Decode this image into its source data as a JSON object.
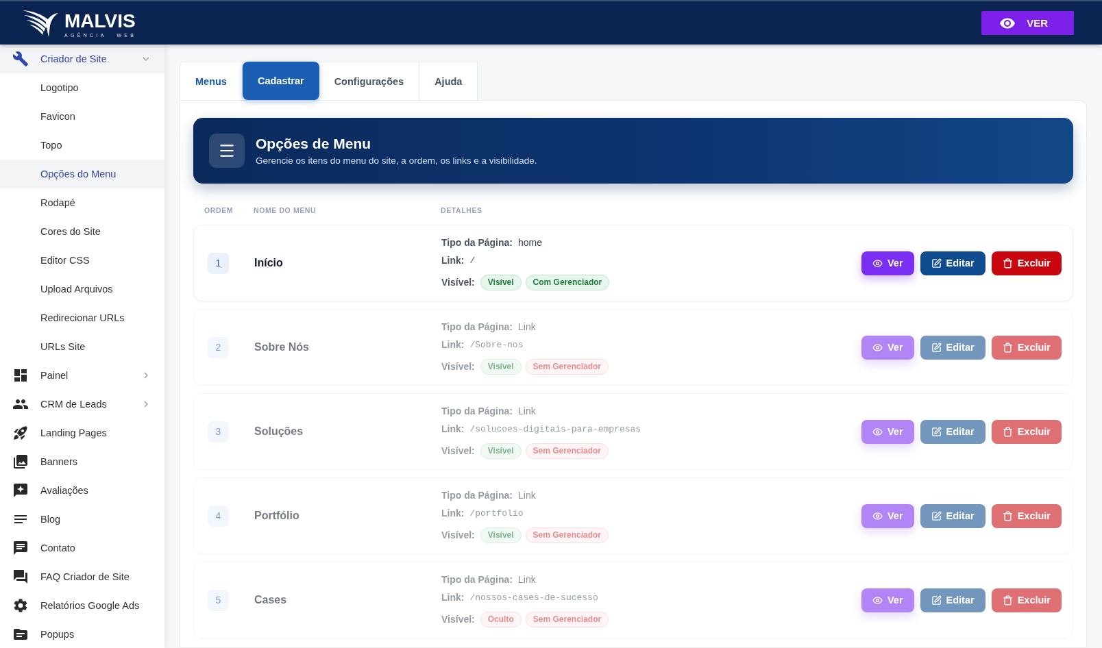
{
  "header": {
    "logo": {
      "name": "MALVIS",
      "tagline": "AGÊNCIA WEB"
    },
    "view_button": "VER"
  },
  "sidebar": {
    "items": [
      {
        "label": "Criador de Site",
        "kind": "group",
        "expanded": true,
        "selected": true,
        "children": [
          {
            "label": "Logotipo",
            "selected": false
          },
          {
            "label": "Favicon",
            "selected": false
          },
          {
            "label": "Topo",
            "selected": false
          },
          {
            "label": "Opções do Menu",
            "selected": true
          },
          {
            "label": "Rodapé",
            "selected": false
          },
          {
            "label": "Cores do Site",
            "selected": false
          },
          {
            "label": "Editor CSS",
            "selected": false
          },
          {
            "label": "Upload Arquivos",
            "selected": false
          },
          {
            "label": "Redirecionar URLs",
            "selected": false
          },
          {
            "label": "URLs Site",
            "selected": false
          }
        ]
      },
      {
        "label": "Painel",
        "kind": "group",
        "expanded": false,
        "selected": false
      },
      {
        "label": "CRM de Leads",
        "kind": "group",
        "expanded": false,
        "selected": false
      },
      {
        "label": "Landing Pages",
        "kind": "link",
        "selected": false
      },
      {
        "label": "Banners",
        "kind": "link",
        "selected": false
      },
      {
        "label": "Avaliações",
        "kind": "link",
        "selected": false
      },
      {
        "label": "Blog",
        "kind": "link",
        "selected": false
      },
      {
        "label": "Contato",
        "kind": "link",
        "selected": false
      },
      {
        "label": "FAQ Criador de Site",
        "kind": "link",
        "selected": false
      },
      {
        "label": "Relatórios Google Ads",
        "kind": "link",
        "selected": false
      },
      {
        "label": "Popups",
        "kind": "link",
        "selected": false
      }
    ]
  },
  "tabs": [
    {
      "label": "Menus",
      "kind": "tab",
      "selected": true
    },
    {
      "label": "Cadastrar",
      "kind": "action",
      "selected": false
    },
    {
      "label": "Configurações",
      "kind": "tab",
      "selected": false
    },
    {
      "label": "Ajuda",
      "kind": "tab",
      "selected": false
    }
  ],
  "banner": {
    "title": "Opções de Menu",
    "subtitle": "Gerencie os itens do menu do site, a ordem, os links e a visibilidade."
  },
  "table": {
    "columns": [
      "ORDEM",
      "NOME DO MENU",
      "DETALHES"
    ],
    "rows": [
      {
        "order": "1",
        "name": "Início",
        "dimmed": false,
        "page_type": {
          "label": "Tipo da Página:",
          "value": "home"
        },
        "link": {
          "label": "Link:",
          "value": "/"
        },
        "visibility": {
          "label": "Visível:",
          "badges": [
            {
              "text": "Visível",
              "kind": "success"
            },
            {
              "text": "Com Gerenciador",
              "kind": "success"
            }
          ]
        },
        "actions": [
          {
            "label": "Ver",
            "kind": "view"
          },
          {
            "label": "Editar",
            "kind": "edit"
          },
          {
            "label": "Excluir",
            "kind": "delete"
          }
        ]
      },
      {
        "order": "2",
        "name": "Sobre Nós",
        "dimmed": true,
        "page_type": {
          "label": "Tipo da Página:",
          "value": "Link"
        },
        "link": {
          "label": "Link:",
          "value": "/Sobre-nos"
        },
        "visibility": {
          "label": "Visível:",
          "badges": [
            {
              "text": "Visível",
              "kind": "success"
            },
            {
              "text": "Sem Gerenciador",
              "kind": "danger"
            }
          ]
        },
        "actions": [
          {
            "label": "Ver",
            "kind": "view"
          },
          {
            "label": "Editar",
            "kind": "edit"
          },
          {
            "label": "Excluir",
            "kind": "delete"
          }
        ]
      },
      {
        "order": "3",
        "name": "Soluções",
        "dimmed": true,
        "page_type": {
          "label": "Tipo da Página:",
          "value": "Link"
        },
        "link": {
          "label": "Link:",
          "value": "/solucoes-digitais-para-empresas"
        },
        "visibility": {
          "label": "Visível:",
          "badges": [
            {
              "text": "Visível",
              "kind": "success"
            },
            {
              "text": "Sem Gerenciador",
              "kind": "danger"
            }
          ]
        },
        "actions": [
          {
            "label": "Ver",
            "kind": "view"
          },
          {
            "label": "Editar",
            "kind": "edit"
          },
          {
            "label": "Excluir",
            "kind": "delete"
          }
        ]
      },
      {
        "order": "4",
        "name": "Portfólio",
        "dimmed": true,
        "page_type": {
          "label": "Tipo da Página:",
          "value": "Link"
        },
        "link": {
          "label": "Link:",
          "value": "/portfolio"
        },
        "visibility": {
          "label": "Visível:",
          "badges": [
            {
              "text": "Visível",
              "kind": "success"
            },
            {
              "text": "Sem Gerenciador",
              "kind": "danger"
            }
          ]
        },
        "actions": [
          {
            "label": "Ver",
            "kind": "view"
          },
          {
            "label": "Editar",
            "kind": "edit"
          },
          {
            "label": "Excluir",
            "kind": "delete"
          }
        ]
      },
      {
        "order": "5",
        "name": "Cases",
        "dimmed": true,
        "page_type": {
          "label": "Tipo da Página:",
          "value": "Link"
        },
        "link": {
          "label": "Link:",
          "value": "/nossos-cases-de-sucesso"
        },
        "visibility": {
          "label": "Visível:",
          "badges": [
            {
              "text": "Oculto",
              "kind": "danger"
            },
            {
              "text": "Sem Gerenciador",
              "kind": "danger"
            }
          ]
        },
        "actions": [
          {
            "label": "Ver",
            "kind": "view"
          },
          {
            "label": "Editar",
            "kind": "edit"
          },
          {
            "label": "Excluir",
            "kind": "delete"
          }
        ]
      }
    ]
  }
}
